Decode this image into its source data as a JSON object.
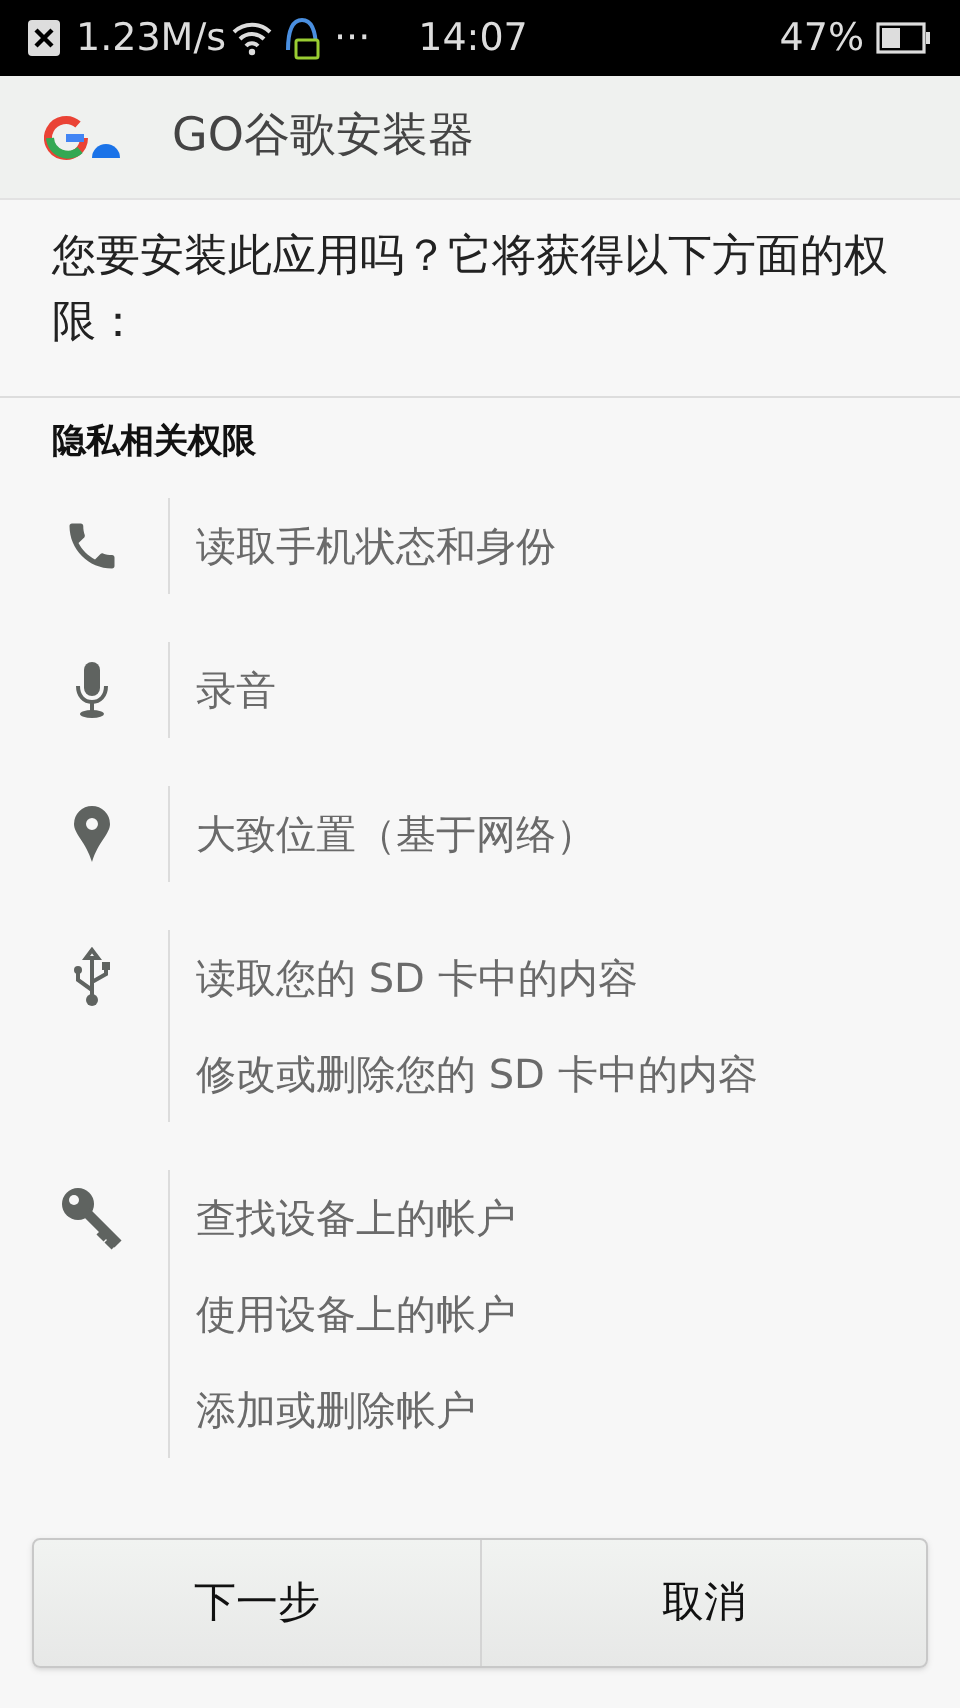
{
  "status_bar": {
    "speed": "1.23M/s",
    "more": "···",
    "time": "14:07",
    "battery": "47%"
  },
  "app_bar": {
    "title": "GO谷歌安装器"
  },
  "question": "您要安装此应用吗？它将获得以下方面的权限：",
  "section": {
    "title": "隐私相关权限"
  },
  "groups": [
    {
      "kind": "phone",
      "items": [
        "读取手机状态和身份"
      ]
    },
    {
      "kind": "mic",
      "items": [
        "录音"
      ]
    },
    {
      "kind": "pin",
      "items": [
        "大致位置（基于网络）"
      ]
    },
    {
      "kind": "usb",
      "items": [
        "读取您的 SD 卡中的内容",
        "修改或删除您的 SD 卡中的内容"
      ]
    },
    {
      "kind": "key",
      "items": [
        "查找设备上的帐户",
        "使用设备上的帐户",
        "添加或删除帐户"
      ]
    }
  ],
  "buttons": [
    "下一步",
    "取消"
  ]
}
